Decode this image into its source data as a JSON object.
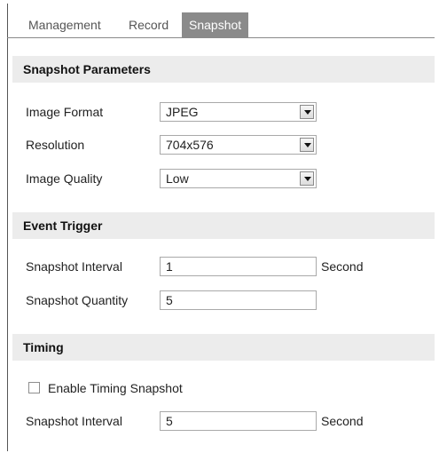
{
  "tabs": [
    {
      "label": "Management",
      "active": false
    },
    {
      "label": "Record",
      "active": false
    },
    {
      "label": "Snapshot",
      "active": true
    }
  ],
  "snapshot_parameters": {
    "title": "Snapshot Parameters",
    "image_format": {
      "label": "Image Format",
      "value": "JPEG"
    },
    "resolution": {
      "label": "Resolution",
      "value": "704x576"
    },
    "image_quality": {
      "label": "Image Quality",
      "value": "Low"
    }
  },
  "event_trigger": {
    "title": "Event Trigger",
    "snapshot_interval": {
      "label": "Snapshot Interval",
      "value": "1",
      "unit": "Second"
    },
    "snapshot_quantity": {
      "label": "Snapshot Quantity",
      "value": "5"
    }
  },
  "timing": {
    "title": "Timing",
    "enable_timing_snapshot": {
      "label": "Enable Timing Snapshot",
      "checked": false
    },
    "snapshot_interval": {
      "label": "Snapshot Interval",
      "value": "5",
      "unit": "Second"
    }
  },
  "colors": {
    "active_tab_bg": "#8a8a8a",
    "section_header_bg": "#ececec"
  }
}
